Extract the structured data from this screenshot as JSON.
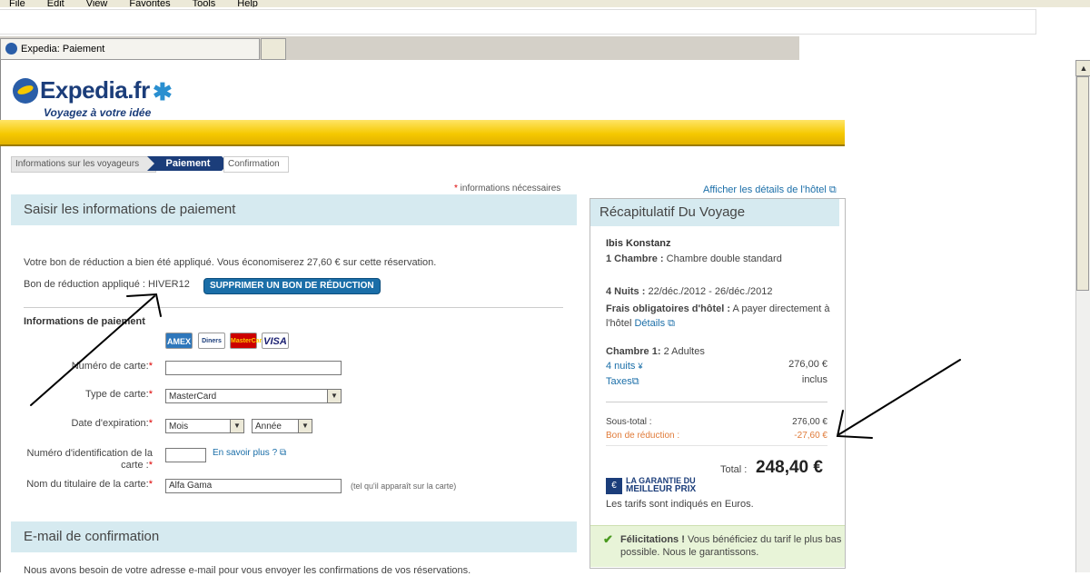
{
  "browser": {
    "menu": [
      "File",
      "Edit",
      "View",
      "Favorites",
      "Tools",
      "Help"
    ],
    "tab_title": "Expedia: Paiement"
  },
  "header": {
    "logo": "Expedia.fr",
    "tagline": "Voyagez à votre idée"
  },
  "breadcrumb": {
    "step1": "Informations sur les voyageurs",
    "step2": "Paiement",
    "step3": "Confirmation"
  },
  "required_note": "informations nécessaires",
  "payment": {
    "title": "Saisir les informations de paiement",
    "voucher_message": "Votre bon de réduction a bien été appliqué. Vous économiserez 27,60 € sur cette réservation.",
    "voucher_applied": "Bon de réduction appliqué : HIVER12",
    "remove_voucher": "SUPPRIMER UN BON DE RÉDUCTION",
    "section_label": "Informations de paiement",
    "cards": [
      "AMEX",
      "Diners",
      "MasterCard",
      "VISA"
    ],
    "card_number_label": "Numéro de carte:",
    "card_type_label": "Type de carte:",
    "card_type_value": "MasterCard",
    "expiry_label": "Date d'expiration:",
    "month_value": "Mois",
    "year_value": "Année",
    "cvv_label": "Numéro d'identification de la carte :",
    "cvv_link": "En savoir plus ?",
    "holder_label": "Nom du titulaire de la carte:",
    "holder_value": "Alfa Gama",
    "holder_hint": "(tel qu'il apparaît sur la carte)"
  },
  "email": {
    "title": "E-mail de confirmation",
    "text": "Nous avons besoin de votre adresse e-mail pour vous envoyer les confirmations de vos réservations."
  },
  "summary": {
    "hotel_link": "Afficher les détails de l'hôtel",
    "title": "Récapitulatif Du Voyage",
    "hotel": "Ibis Konstanz",
    "room_label": "1 Chambre :",
    "room_value": "Chambre double standard",
    "nights_label": "4 Nuits :",
    "nights_value": "22/déc./2012 - 26/déc./2012",
    "fees_label": "Frais obligatoires d'hôtel :",
    "fees_value": "A payer directement à l'hôtel",
    "fees_link": "Détails",
    "room1_label": "Chambre 1:",
    "room1_value": "2 Adultes",
    "nights_link": "4 nuits",
    "nights_amount": "276,00 €",
    "taxes_link": "Taxes",
    "taxes_value": "inclus",
    "subtotal_label": "Sous-total :",
    "subtotal_value": "276,00 €",
    "discount_label": "Bon de réduction :",
    "discount_value": "-27,60 €",
    "total_label": "Total :",
    "total_value": "248,40 €",
    "guarantee_line1": "LA GARANTIE DU",
    "guarantee_line2": "MEILLEUR PRIX",
    "currency_note": "Les tarifs sont indiqués en Euros.",
    "congrats_bold": "Félicitations !",
    "congrats_text": "Vous bénéficiez du tarif le plus bas possible. Nous le garantissons."
  },
  "colors": {
    "brand_blue": "#1b3d7a",
    "brand_yellow": "#f5c800",
    "section_bg": "#d6eaf0",
    "link": "#1a6ea8",
    "discount": "#e07b39",
    "success_bg": "#e8f4d8"
  }
}
